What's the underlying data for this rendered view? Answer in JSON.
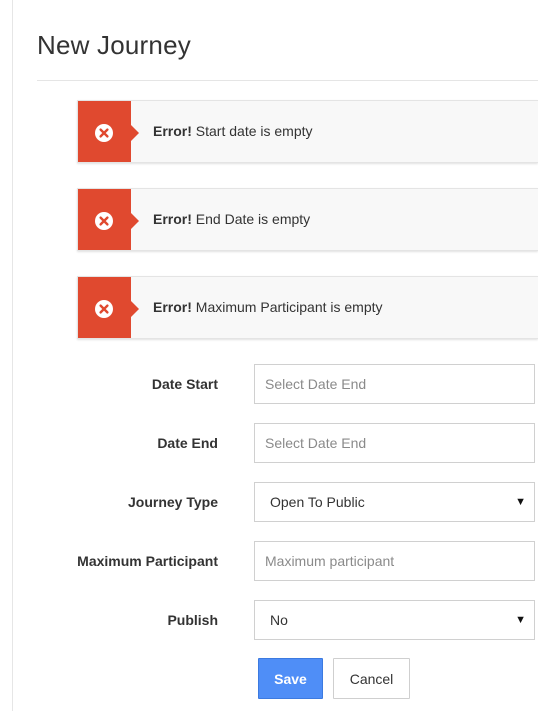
{
  "page": {
    "title": "New Journey"
  },
  "alerts": [
    {
      "strong": "Error!",
      "message": " Start date is empty"
    },
    {
      "strong": "Error!",
      "message": " End Date is empty"
    },
    {
      "strong": "Error!",
      "message": " Maximum Participant is empty"
    }
  ],
  "form": {
    "date_start": {
      "label": "Date Start",
      "placeholder": "Select Date End",
      "value": ""
    },
    "date_end": {
      "label": "Date End",
      "placeholder": "Select Date End",
      "value": ""
    },
    "journey_type": {
      "label": "Journey Type",
      "selected": "Open To Public"
    },
    "max_participant": {
      "label": "Maximum Participant",
      "placeholder": "Maximum participant",
      "value": ""
    },
    "publish": {
      "label": "Publish",
      "selected": "No"
    }
  },
  "actions": {
    "save_label": "Save",
    "cancel_label": "Cancel"
  },
  "colors": {
    "error_accent": "#e0492f",
    "primary_button": "#4f8ef7"
  },
  "icons": {
    "alert": "error-circle-x-icon",
    "select": "dropdown-arrow-icon"
  }
}
